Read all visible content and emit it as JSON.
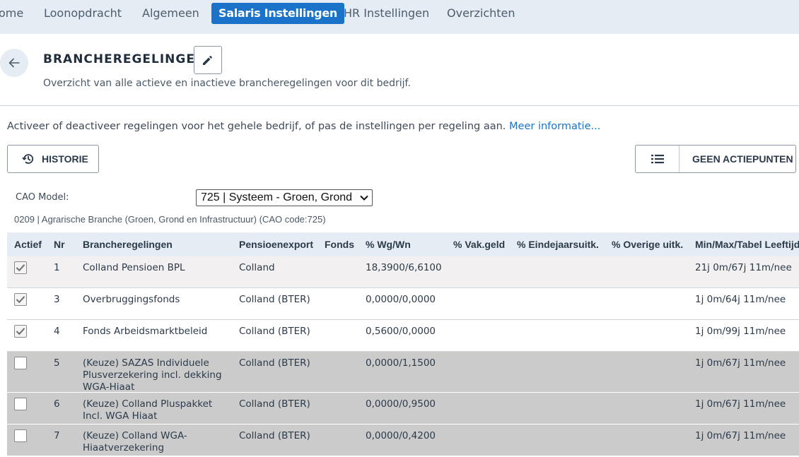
{
  "nav": {
    "items": [
      {
        "label": "ome"
      },
      {
        "label": "Loonopdracht"
      },
      {
        "label": "Algemeen"
      },
      {
        "label": "Salaris Instellingen"
      },
      {
        "label": "HR Instellingen"
      },
      {
        "label": "Overzichten"
      }
    ],
    "active_index": 3
  },
  "header": {
    "title": "BRANCHEREGELINGEN",
    "subtitle": "Overzicht van alle actieve en inactieve brancheregelingen voor dit bedrijf."
  },
  "intro": {
    "text": "Activeer of deactiveer regelingen voor het gehele bedrijf, of pas de instellingen per regeling aan.",
    "link": "Meer informatie..."
  },
  "buttons": {
    "historie": "HISTORIE",
    "actiepunten": "GEEN ACTIEPUNTEN"
  },
  "cao": {
    "label": "CAO Model:",
    "selected": "725 | Systeem - Groen, Grond",
    "description": "0209 | Agrarische Branche (Groen, Grond en Infrastructuur) (CAO code:725)"
  },
  "table": {
    "columns": [
      "Actief",
      "Nr",
      "Brancheregelingen",
      "Pensioenexport",
      "Fonds",
      "% Wg/Wn",
      "% Vak.geld",
      "% Eindejaarsuitk.",
      "% Overige uitk.",
      "Min/Max/Tabel Leeftijd"
    ],
    "rows": [
      {
        "active": true,
        "nr": "1",
        "name": "Colland Pensioen BPL",
        "export": "Colland",
        "fonds": "",
        "wgwn": "18,3900/6,6100",
        "vak": "",
        "eind": "",
        "overig": "",
        "leeftijd": "21j 0m/67j 11m/nee"
      },
      {
        "active": true,
        "nr": "3",
        "name": "Overbruggingsfonds",
        "export": "Colland (BTER)",
        "fonds": "",
        "wgwn": "0,0000/0,0000",
        "vak": "",
        "eind": "",
        "overig": "",
        "leeftijd": "1j 0m/64j 11m/nee"
      },
      {
        "active": true,
        "nr": "4",
        "name": "Fonds Arbeidsmarktbeleid",
        "export": "Colland (BTER)",
        "fonds": "",
        "wgwn": "0,5600/0,0000",
        "vak": "",
        "eind": "",
        "overig": "",
        "leeftijd": "1j 0m/99j 11m/nee"
      },
      {
        "active": false,
        "nr": "5",
        "name": "(Keuze) SAZAS Individuele Plusverzekering incl. dekking WGA-Hiaat",
        "export": "Colland (BTER)",
        "fonds": "",
        "wgwn": "0,0000/1,1500",
        "vak": "",
        "eind": "",
        "overig": "",
        "leeftijd": "1j 0m/67j 11m/nee"
      },
      {
        "active": false,
        "nr": "6",
        "name": "(Keuze) Colland Pluspakket Incl. WGA Hiaat",
        "export": "Colland (BTER)",
        "fonds": "",
        "wgwn": "0,0000/0,9500",
        "vak": "",
        "eind": "",
        "overig": "",
        "leeftijd": "1j 0m/67j 11m/nee"
      },
      {
        "active": false,
        "nr": "7",
        "name": "(Keuze) Colland WGA-Hiaatverzekering",
        "export": "Colland (BTER)",
        "fonds": "",
        "wgwn": "0,0000/0,4200",
        "vak": "",
        "eind": "",
        "overig": "",
        "leeftijd": "1j 0m/67j 11m/nee"
      }
    ]
  },
  "colors": {
    "accent": "#1a73c8",
    "nav_bg": "#e5ecf3",
    "inactive_row": "#cbcbcb"
  }
}
